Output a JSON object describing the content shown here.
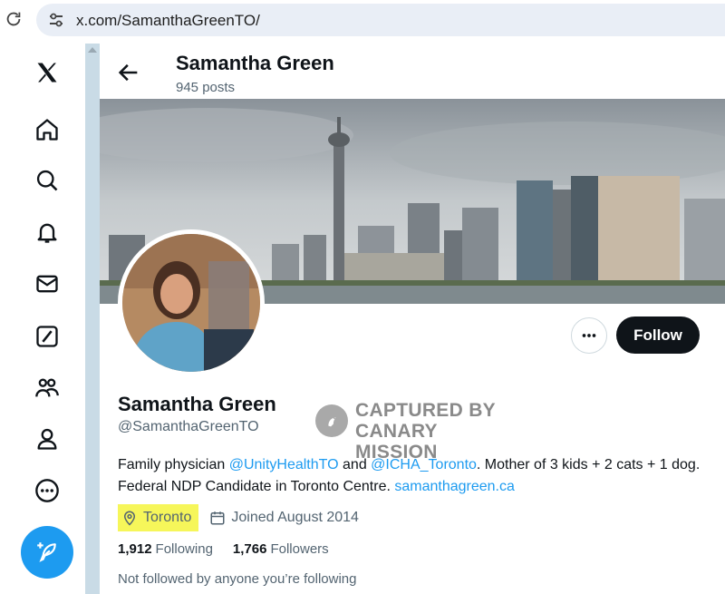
{
  "browser": {
    "url": "x.com/SamanthaGreenTO/"
  },
  "nav": {
    "items": [
      "x-logo",
      "home",
      "explore",
      "notifications",
      "messages",
      "grok",
      "communities",
      "profile",
      "more"
    ],
    "compose_icon": "feather-plus-icon"
  },
  "header": {
    "name": "Samantha Green",
    "posts": "945 posts"
  },
  "profile": {
    "name": "Samantha Green",
    "handle": "@SamanthaGreenTO",
    "follow_label": "Follow",
    "bio": {
      "part1": "Family physician ",
      "mention1": "@UnityHealthTO",
      "part2": " and ",
      "mention2": "@ICHA_Toronto",
      "part3": ". Mother of 3 kids + 2 cats + 1 dog. Federal NDP Candidate in Toronto Centre. ",
      "website": "samanthagreen.ca"
    },
    "location": "Toronto",
    "joined": "Joined August 2014",
    "following_count": "1,912",
    "following_label": "Following",
    "followers_count": "1,766",
    "followers_label": "Followers",
    "not_followed": "Not followed by anyone you’re following"
  },
  "watermark": {
    "line1": "CAPTURED BY",
    "line2": "CANARY MISSION"
  },
  "colors": {
    "accent": "#1d9bf0",
    "highlight": "#f6f65a",
    "follow_bg": "#0f1419"
  }
}
